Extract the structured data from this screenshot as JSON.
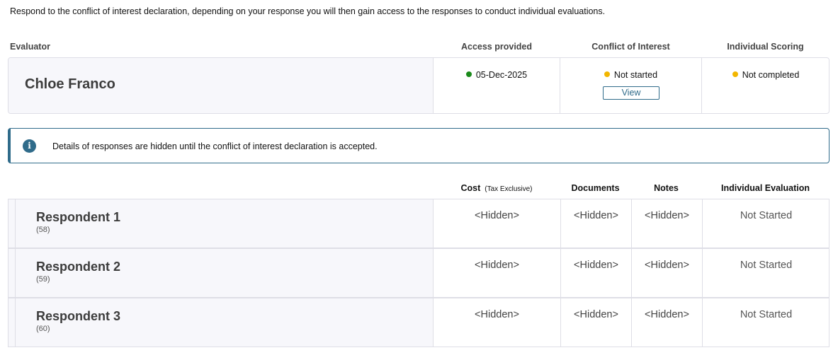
{
  "intro_text": "Respond to the conflict of interest declaration, depending on your response you will then gain access to the responses to conduct individual evaluations.",
  "evaluator_table": {
    "headers": {
      "evaluator": "Evaluator",
      "access": "Access provided",
      "coi": "Conflict of Interest",
      "scoring": "Individual Scoring"
    },
    "row": {
      "name": "Chloe Franco",
      "access_date": "05-Dec-2025",
      "access_status_color": "#1a8a1a",
      "coi_status": "Not started",
      "coi_status_color": "#f2b600",
      "view_label": "View",
      "scoring_status": "Not completed",
      "scoring_status_color": "#f2b600"
    }
  },
  "info_banner": {
    "icon": "info-icon",
    "text": "Details of responses are hidden until the conflict of interest declaration is accepted."
  },
  "respondents_table": {
    "headers": {
      "cost": "Cost",
      "cost_note": "(Tax Exclusive)",
      "documents": "Documents",
      "notes": "Notes",
      "evaluation": "Individual Evaluation"
    },
    "rows": [
      {
        "name": "Respondent 1",
        "id": "(58)",
        "cost": "<Hidden>",
        "documents": "<Hidden>",
        "notes": "<Hidden>",
        "evaluation": "Not Started"
      },
      {
        "name": "Respondent 2",
        "id": "(59)",
        "cost": "<Hidden>",
        "documents": "<Hidden>",
        "notes": "<Hidden>",
        "evaluation": "Not Started"
      },
      {
        "name": "Respondent 3",
        "id": "(60)",
        "cost": "<Hidden>",
        "documents": "<Hidden>",
        "notes": "<Hidden>",
        "evaluation": "Not Started"
      }
    ]
  }
}
